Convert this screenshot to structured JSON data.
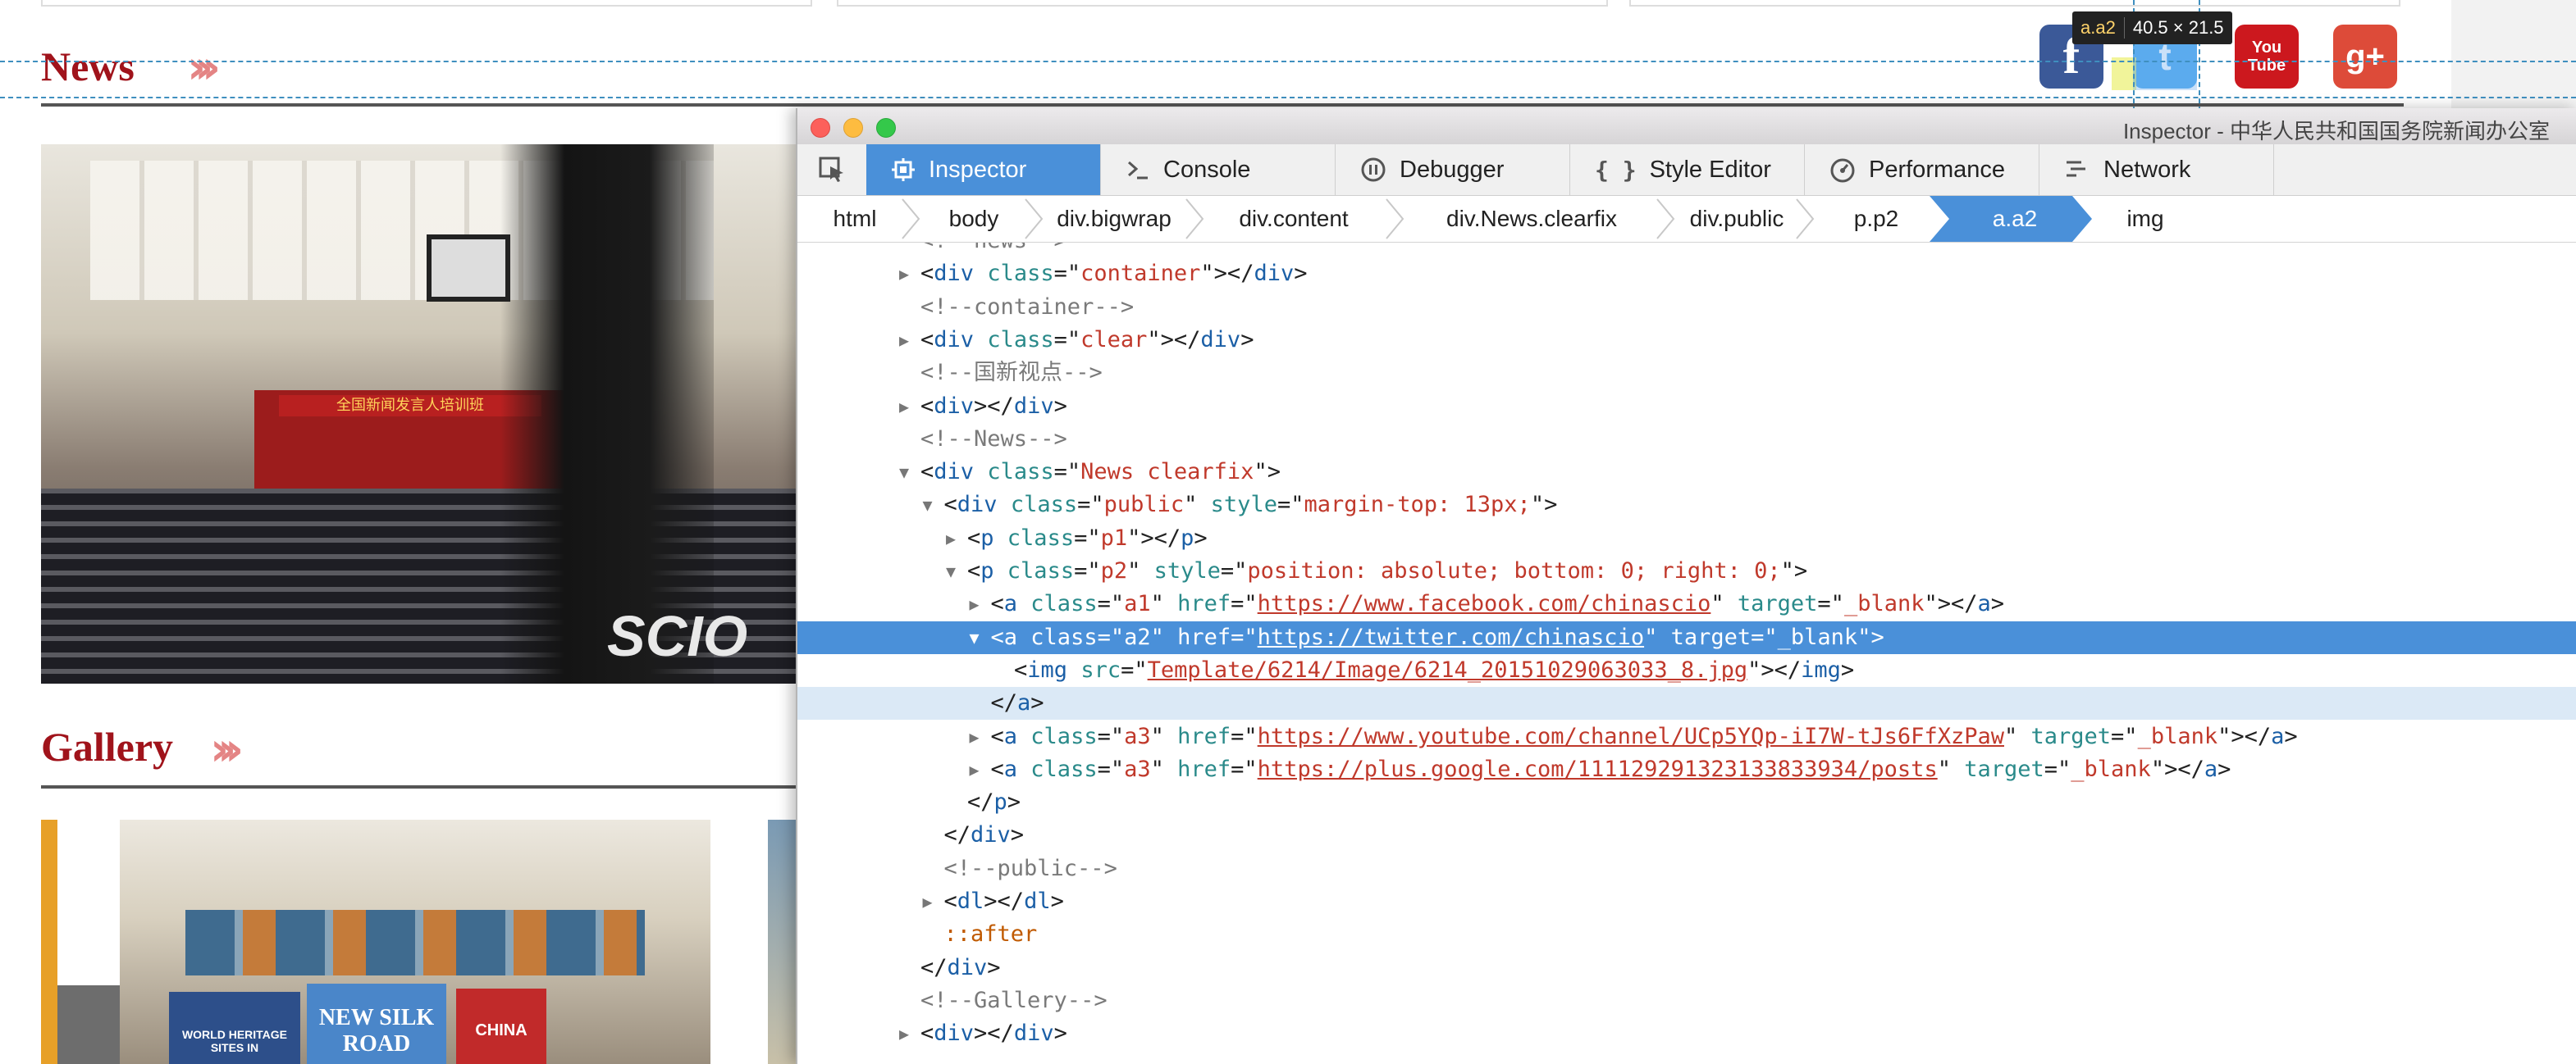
{
  "page": {
    "news_title": "News",
    "gallery_title": "Gallery",
    "chevrons": "›››",
    "photo_sign": "全国新闻发言人培训班",
    "watermark": "SCIO",
    "books": [
      "WORLD HERITAGE SITES IN",
      "NEW SILK ROAD",
      "CHINA"
    ]
  },
  "social": [
    {
      "name": "facebook",
      "glyph": "f",
      "color": "#3b5998"
    },
    {
      "name": "twitter",
      "glyph": "t",
      "color": "#55acee"
    },
    {
      "name": "youtube",
      "glyph": "You Tube",
      "color": "#cc181e"
    },
    {
      "name": "google-plus",
      "glyph": "g+",
      "color": "#dd4b39"
    }
  ],
  "tooltip": {
    "selector": "a.a2",
    "size": "40.5 × 21.5"
  },
  "devtools": {
    "window_title": "Inspector - 中华人民共和国国务院新闻办公室",
    "tabs": [
      {
        "label": "Inspector",
        "icon": "inspector-icon",
        "selected": true
      },
      {
        "label": "Console",
        "icon": "console-icon"
      },
      {
        "label": "Debugger",
        "icon": "debugger-icon"
      },
      {
        "label": "Style Editor",
        "icon": "style-editor-icon"
      },
      {
        "label": "Performance",
        "icon": "performance-icon"
      },
      {
        "label": "Network",
        "icon": "network-icon"
      }
    ],
    "breadcrumbs": [
      "html",
      "body",
      "div.bigwrap",
      "div.content",
      "div.News.clearfix",
      "div.public",
      "p.p2",
      "a.a2",
      "img"
    ],
    "selected_crumb": "a.a2",
    "code_lines": [
      {
        "indent": 0,
        "tw": "",
        "html": "<span class='c'>&lt;!--news--&gt;</span>"
      },
      {
        "indent": 0,
        "tw": "▶",
        "html": "&lt;<span class='t'>div</span> <span class='a'>class</span>=\"<span class='v'>container</span>\"&gt;&lt;/<span class='t'>div</span>&gt;"
      },
      {
        "indent": 0,
        "tw": "",
        "html": "<span class='c'>&lt;!--container--&gt;</span>"
      },
      {
        "indent": 0,
        "tw": "▶",
        "html": "&lt;<span class='t'>div</span> <span class='a'>class</span>=\"<span class='v'>clear</span>\"&gt;&lt;/<span class='t'>div</span>&gt;"
      },
      {
        "indent": 0,
        "tw": "",
        "html": "<span class='c'>&lt;!--国新视点--&gt;</span>"
      },
      {
        "indent": 0,
        "tw": "▶",
        "html": "&lt;<span class='t'>div</span>&gt;&lt;/<span class='t'>div</span>&gt;"
      },
      {
        "indent": 0,
        "tw": "",
        "html": "<span class='c'>&lt;!--News--&gt;</span>"
      },
      {
        "indent": 0,
        "tw": "▼",
        "html": "&lt;<span class='t'>div</span> <span class='a'>class</span>=\"<span class='v'>News clearfix</span>\"&gt;"
      },
      {
        "indent": 1,
        "tw": "▼",
        "html": "&lt;<span class='t'>div</span> <span class='a'>class</span>=\"<span class='v'>public</span>\" <span class='a'>style</span>=\"<span class='v'>margin-top: 13px;</span>\"&gt;"
      },
      {
        "indent": 2,
        "tw": "▶",
        "html": "&lt;<span class='t'>p</span> <span class='a'>class</span>=\"<span class='v'>p1</span>\"&gt;&lt;/<span class='t'>p</span>&gt;"
      },
      {
        "indent": 2,
        "tw": "▼",
        "html": "&lt;<span class='t'>p</span> <span class='a'>class</span>=\"<span class='v'>p2</span>\" <span class='a'>style</span>=\"<span class='v'>position: absolute; bottom: 0; right: 0;</span>\"&gt;"
      },
      {
        "indent": 3,
        "tw": "▶",
        "html": "&lt;<span class='t'>a</span> <span class='a'>class</span>=\"<span class='v'>a1</span>\" <span class='a'>href</span>=\"<span class='u'>https://www.facebook.com/chinascio</span>\" <span class='a'>target</span>=\"<span class='v'>_blank</span>\"&gt;&lt;/<span class='t'>a</span>&gt;"
      },
      {
        "indent": 3,
        "tw": "▼",
        "hl": true,
        "html": "&lt;<span class='t'>a</span> <span class='a'>class</span>=\"<span class='v'>a2</span>\" <span class='a'>href</span>=\"<span class='u'>https://twitter.com/chinascio</span>\" <span class='a'>target</span>=\"<span class='v'>_blank</span>\"&gt;"
      },
      {
        "indent": 4,
        "tw": "",
        "html": "&lt;<span class='t'>img</span> <span class='a'>src</span>=\"<span class='u'>Template/6214/Image/6214_20151029063033_8.jpg</span>\"&gt;&lt;/<span class='t'>img</span>&gt;"
      },
      {
        "indent": 3,
        "tw": "",
        "hl2": true,
        "html": "&lt;/<span class='t'>a</span>&gt;"
      },
      {
        "indent": 3,
        "tw": "▶",
        "html": "&lt;<span class='t'>a</span> <span class='a'>class</span>=\"<span class='v'>a3</span>\" <span class='a'>href</span>=\"<span class='u'>https://www.youtube.com/channel/UCp5YQp-iI7W-tJs6FfXzPaw</span>\" <span class='a'>target</span>=\"<span class='v'>_blank</span>\"&gt;&lt;/<span class='t'>a</span>&gt;"
      },
      {
        "indent": 3,
        "tw": "▶",
        "html": "&lt;<span class='t'>a</span> <span class='a'>class</span>=\"<span class='v'>a3</span>\" <span class='a'>href</span>=\"<span class='u'>https://plus.google.com/111129291323133833934/posts</span>\" <span class='a'>target</span>=\"<span class='v'>_blank</span>\"&gt;&lt;/<span class='t'>a</span>&gt;"
      },
      {
        "indent": 2,
        "tw": "",
        "html": "&lt;/<span class='t'>p</span>&gt;"
      },
      {
        "indent": 1,
        "tw": "",
        "html": "&lt;/<span class='t'>div</span>&gt;"
      },
      {
        "indent": 1,
        "tw": "",
        "html": "<span class='c'>&lt;!--public--&gt;</span>"
      },
      {
        "indent": 1,
        "tw": "▶",
        "html": "&lt;<span class='t'>dl</span>&gt;&lt;/<span class='t'>dl</span>&gt;"
      },
      {
        "indent": 1,
        "tw": "",
        "html": "<span class='p'>::after</span>"
      },
      {
        "indent": 0,
        "tw": "",
        "html": "&lt;/<span class='t'>div</span>&gt;"
      },
      {
        "indent": 0,
        "tw": "",
        "html": "<span class='c'>&lt;!--Gallery--&gt;</span>"
      },
      {
        "indent": 0,
        "tw": "▶",
        "html": "&lt;<span class='t'>div</span>&gt;&lt;/<span class='t'>div</span>&gt;"
      }
    ]
  }
}
